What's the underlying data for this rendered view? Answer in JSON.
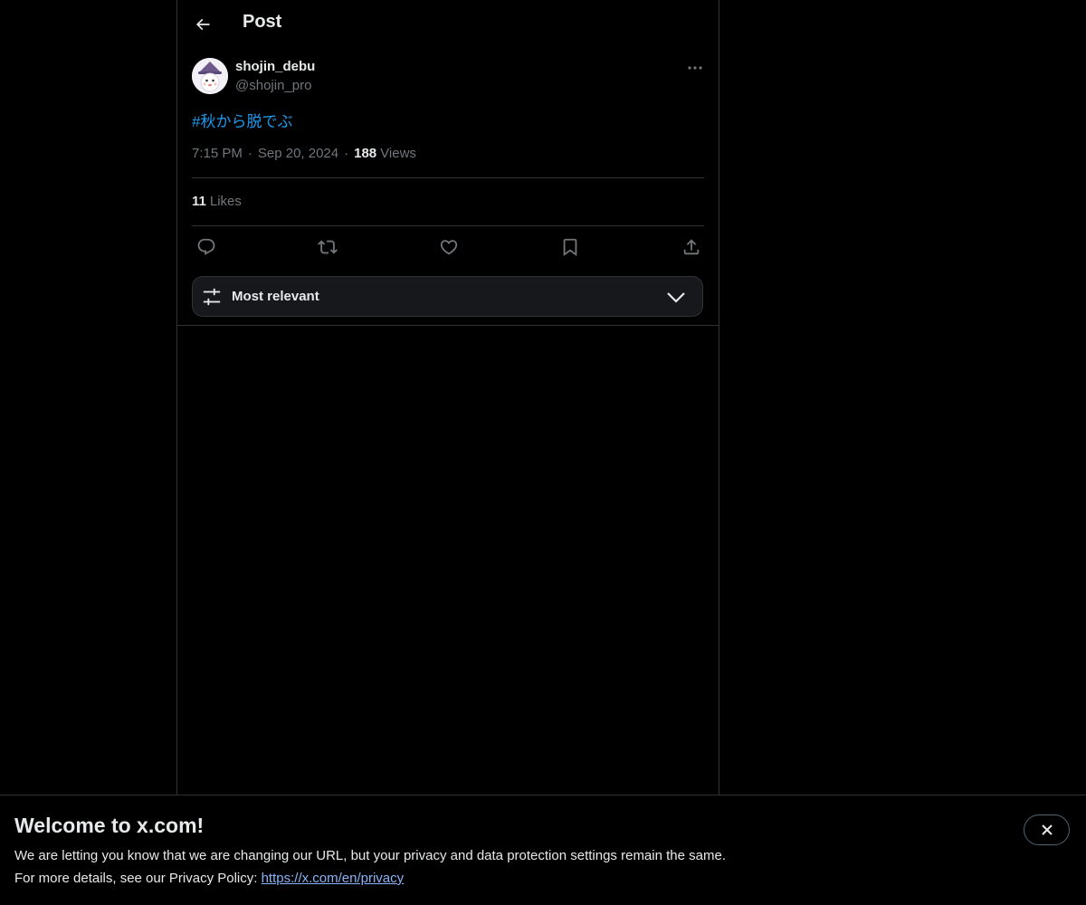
{
  "header": {
    "title": "Post"
  },
  "post": {
    "author": {
      "display_name": "shojin_debu",
      "handle": "@shojin_pro"
    },
    "text": "#秋から脱でぶ",
    "time": "7:15 PM",
    "date": "Sep 20, 2024",
    "separator": "·",
    "views_count": "188",
    "views_label": "Views",
    "likes_count": "11",
    "likes_label": "Likes"
  },
  "actions": [
    "reply-icon",
    "repost-icon",
    "like-icon",
    "bookmark-icon",
    "share-icon"
  ],
  "sort": {
    "label": "Most relevant"
  },
  "banner": {
    "title": "Welcome to x.com!",
    "line1": "We are letting you know that we are changing our URL, but your privacy and data protection settings remain the same.",
    "line2_prefix": "For more details, see our Privacy Policy: ",
    "link": "https://x.com/en/privacy"
  },
  "colors": {
    "background": "#000000",
    "text": "#e7e9ea",
    "muted": "#71767b",
    "accent": "#1d9bf0",
    "border": "#2f3336"
  }
}
